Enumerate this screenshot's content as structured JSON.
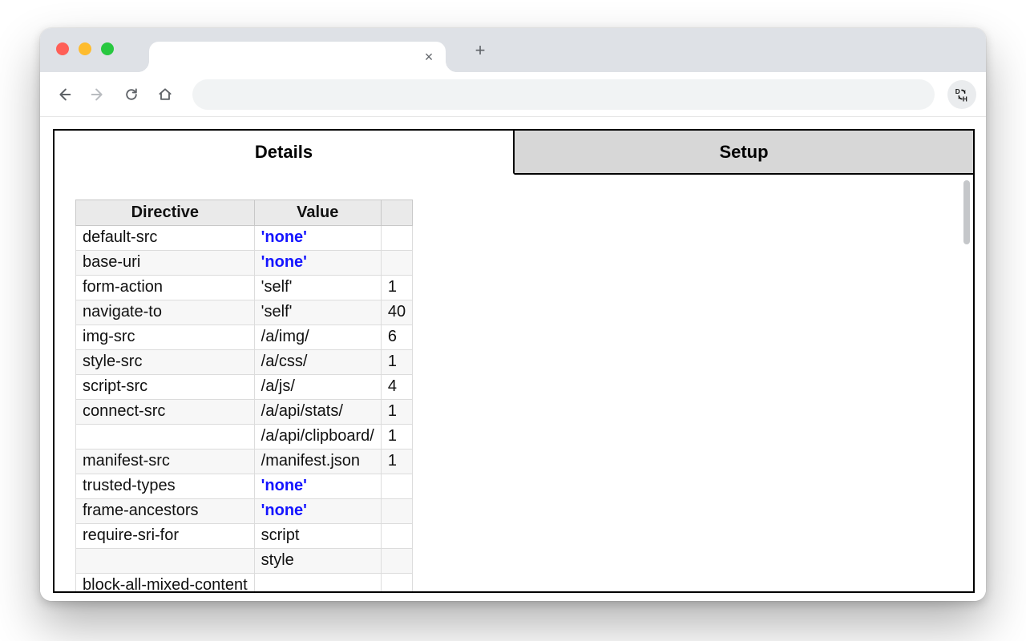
{
  "browser": {
    "tab_title": "",
    "close_glyph": "×",
    "newtab_glyph": "+"
  },
  "panel": {
    "tabs": {
      "details": "Details",
      "setup": "Setup"
    },
    "headers": {
      "directive": "Directive",
      "value": "Value",
      "count": ""
    },
    "rows": [
      {
        "directive": "default-src",
        "value": "'none'",
        "keyword": true,
        "count": ""
      },
      {
        "directive": "base-uri",
        "value": "'none'",
        "keyword": true,
        "count": ""
      },
      {
        "directive": "form-action",
        "value": "'self'",
        "keyword": false,
        "count": "1"
      },
      {
        "directive": "navigate-to",
        "value": "'self'",
        "keyword": false,
        "count": "40"
      },
      {
        "directive": "img-src",
        "value": "/a/img/",
        "keyword": false,
        "count": "6"
      },
      {
        "directive": "style-src",
        "value": "/a/css/",
        "keyword": false,
        "count": "1"
      },
      {
        "directive": "script-src",
        "value": "/a/js/",
        "keyword": false,
        "count": "4"
      },
      {
        "directive": "connect-src",
        "value": "/a/api/stats/",
        "keyword": false,
        "count": "1"
      },
      {
        "directive": "",
        "value": "/a/api/clipboard/",
        "keyword": false,
        "count": "1"
      },
      {
        "directive": "manifest-src",
        "value": "/manifest.json",
        "keyword": false,
        "count": "1"
      },
      {
        "directive": "trusted-types",
        "value": "'none'",
        "keyword": true,
        "count": ""
      },
      {
        "directive": "frame-ancestors",
        "value": "'none'",
        "keyword": true,
        "count": ""
      },
      {
        "directive": "require-sri-for",
        "value": "script",
        "keyword": false,
        "count": ""
      },
      {
        "directive": "",
        "value": "style",
        "keyword": false,
        "count": ""
      },
      {
        "directive": "block-all-mixed-content",
        "value": "",
        "keyword": false,
        "count": ""
      }
    ]
  }
}
